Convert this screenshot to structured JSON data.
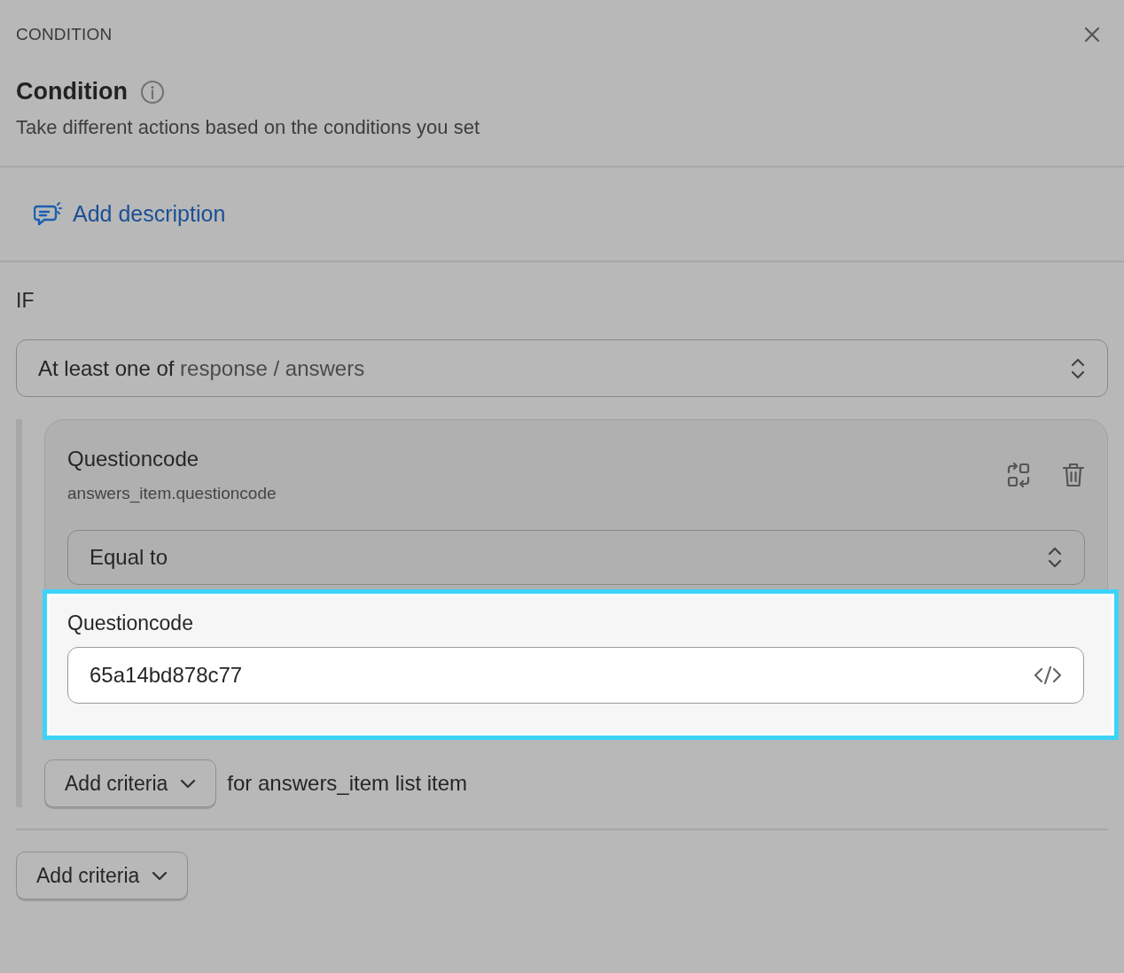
{
  "panel": {
    "eyebrow": "CONDITION",
    "title": "Condition",
    "subtitle": "Take different actions based on the conditions you set"
  },
  "description_link": "Add description",
  "section_label": "IF",
  "scope_select": {
    "prefix": "At least one of",
    "path": "response / answers"
  },
  "criterion": {
    "title": "Questioncode",
    "path": "answers_item.questioncode",
    "operator": "Equal to",
    "value_field": {
      "label": "Questioncode",
      "value": "65a14bd878c77",
      "highlighted": true
    }
  },
  "inner_add": {
    "label": "Add criteria",
    "suffix": "for answers_item list item"
  },
  "outer_add": {
    "label": "Add criteria"
  }
}
